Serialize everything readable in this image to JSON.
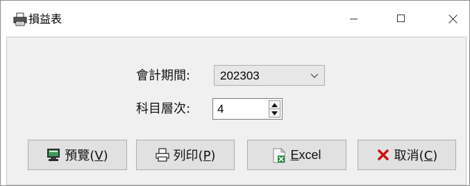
{
  "window": {
    "title": "損益表",
    "icon": "printer-icon",
    "controls": {
      "minimize": "—",
      "maximize": "☐",
      "close": "✕"
    }
  },
  "form": {
    "period_label": "會計期間:",
    "period_value": "202303",
    "level_label": "科目層次:",
    "level_value": "4"
  },
  "buttons": {
    "preview": {
      "text": "預覽(",
      "accel": "V",
      "tail": ")",
      "icon": "monitor-icon"
    },
    "print": {
      "text": "列印(",
      "accel": "P",
      "tail": ")",
      "icon": "printer-icon"
    },
    "excel": {
      "text": "",
      "accel": "E",
      "tail": "xcel",
      "icon": "excel-file-icon"
    },
    "cancel": {
      "text": "取消(",
      "accel": "C",
      "tail": ")",
      "icon": "x-icon"
    }
  },
  "colors": {
    "cancel_x": "#cc1111",
    "excel_green": "#1f8a3a"
  }
}
